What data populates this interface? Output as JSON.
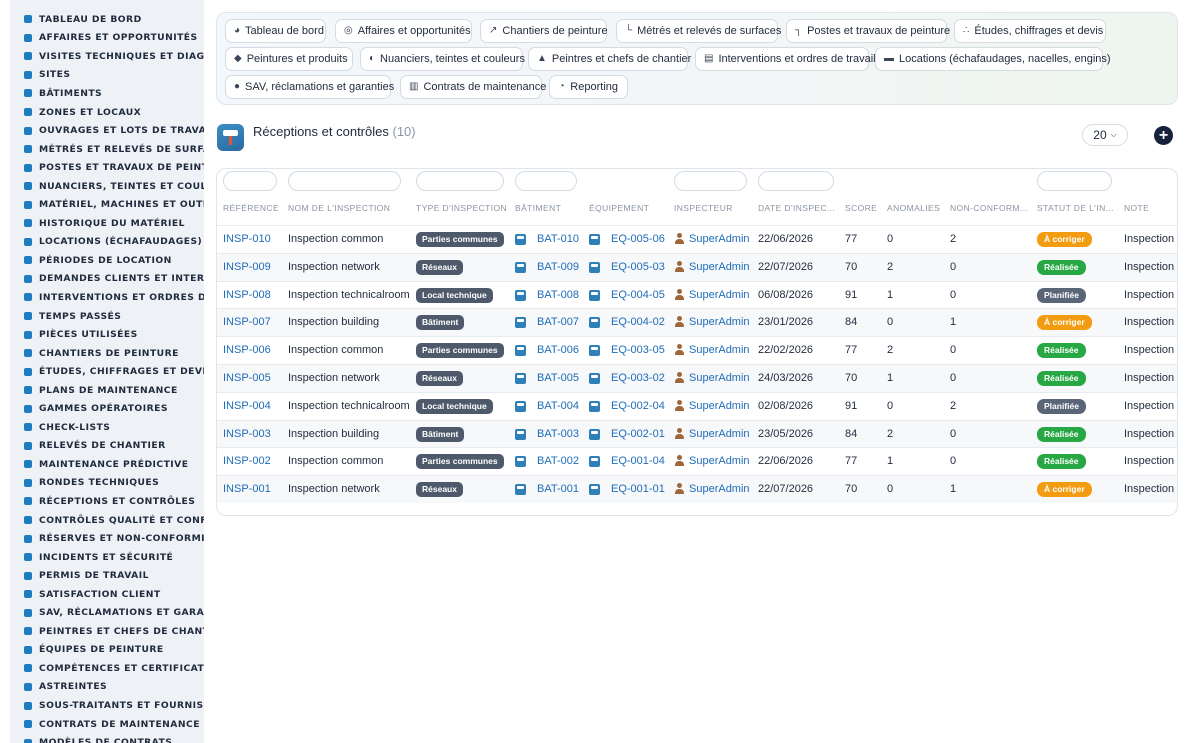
{
  "sidebar": {
    "items": [
      {
        "label": "TABLEAU DE BORD",
        "icon": "dashboard-icon"
      },
      {
        "label": "AFFAIRES ET OPPORTUNITÉS",
        "icon": "target-icon"
      },
      {
        "label": "VISITES TECHNIQUES ET DIAGNOSTICS",
        "icon": "clipboard-icon"
      },
      {
        "label": "SITES",
        "icon": "map-pin-icon"
      },
      {
        "label": "BÂTIMENTS",
        "icon": "building-icon"
      },
      {
        "label": "ZONES ET LOCAUX",
        "icon": "grid-icon"
      },
      {
        "label": "OUVRAGES ET LOTS DE TRAVAUX",
        "icon": "sitemap-icon"
      },
      {
        "label": "MÉTRÉS ET RELEVÉS DE SURFACES",
        "icon": "ruler-icon"
      },
      {
        "label": "POSTES ET TRAVAUX DE PEINTURE",
        "icon": "paint-roller-icon"
      },
      {
        "label": "NUANCIERS, TEINTES ET COULEURS",
        "icon": "palette-icon"
      },
      {
        "label": "MATÉRIEL, MACHINES ET OUTILLAGE",
        "icon": "cogs-icon"
      },
      {
        "label": "HISTORIQUE DU MATÉRIEL",
        "icon": "history-icon"
      },
      {
        "label": "LOCATIONS (ÉCHAFAUDAGES)",
        "icon": "truck-icon"
      },
      {
        "label": "PÉRIODES DE LOCATION",
        "icon": "calendar-icon"
      },
      {
        "label": "DEMANDES CLIENTS ET INTERVENTIONS",
        "icon": "inbox-icon"
      },
      {
        "label": "INTERVENTIONS ET ORDRES DE TRAVAIL",
        "icon": "tools-icon"
      },
      {
        "label": "TEMPS PASSÉS",
        "icon": "clock-icon"
      },
      {
        "label": "PIÈCES UTILISÉES",
        "icon": "box-icon"
      },
      {
        "label": "CHANTIERS DE PEINTURE",
        "icon": "brush-icon"
      },
      {
        "label": "ÉTUDES, CHIFFRAGES ET DEVIS",
        "icon": "calculator-icon"
      },
      {
        "label": "PLANS DE MAINTENANCE",
        "icon": "calendar-check-icon"
      },
      {
        "label": "GAMMES OPÉRATOIRES",
        "icon": "list-ordered-icon"
      },
      {
        "label": "CHECK-LISTS",
        "icon": "checklist-icon"
      },
      {
        "label": "RELEVÉS DE CHANTIER",
        "icon": "file-icon"
      },
      {
        "label": "MAINTENANCE PRÉDICTIVE",
        "icon": "chart-line-icon"
      },
      {
        "label": "RONDES TECHNIQUES",
        "icon": "route-icon"
      },
      {
        "label": "RÉCEPTIONS ET CONTRÔLES",
        "icon": "search-check-icon"
      },
      {
        "label": "CONTRÔLES QUALITÉ ET CONFORMITÉ",
        "icon": "clipboard-check-icon"
      },
      {
        "label": "RÉSERVES ET NON-CONFORMITÉS",
        "icon": "alert-circle-icon"
      },
      {
        "label": "INCIDENTS ET SÉCURITÉ",
        "icon": "warning-icon"
      },
      {
        "label": "PERMIS DE TRAVAIL",
        "icon": "file-signature-icon"
      },
      {
        "label": "SATISFACTION CLIENT",
        "icon": "smile-icon"
      },
      {
        "label": "SAV, RÉCLAMATIONS ET GARANTIES",
        "icon": "comments-icon"
      },
      {
        "label": "PEINTRES ET CHEFS DE CHANTIER",
        "icon": "hard-hat-icon"
      },
      {
        "label": "ÉQUIPES DE PEINTURE",
        "icon": "users-icon"
      },
      {
        "label": "COMPÉTENCES ET CERTIFICATIONS",
        "icon": "award-icon"
      },
      {
        "label": "ASTREINTES",
        "icon": "phone-icon"
      },
      {
        "label": "SOUS-TRAITANTS ET FOURNISSEURS",
        "icon": "handshake-icon"
      },
      {
        "label": "CONTRATS DE MAINTENANCE",
        "icon": "contract-icon"
      },
      {
        "label": "MODÈLES DE CONTRATS",
        "icon": "file-text-icon"
      }
    ]
  },
  "topnav": {
    "buttons": [
      {
        "label": "Tableau de bord",
        "icon": "dashboard-icon"
      },
      {
        "label": "Affaires et opportunités",
        "icon": "target-icon"
      },
      {
        "label": "Chantiers de peinture",
        "icon": "brush-icon"
      },
      {
        "label": "Métrés et relevés de surfaces",
        "icon": "ruler-icon"
      },
      {
        "label": "Postes et travaux de peinture",
        "icon": "paint-roller-icon"
      },
      {
        "label": "Études, chiffrages et devis",
        "icon": "sitemap-icon"
      },
      {
        "label": "Peintures et produits",
        "icon": "fill-drip-icon"
      },
      {
        "label": "Nuanciers, teintes et couleurs",
        "icon": "palette-icon"
      },
      {
        "label": "Peintres et chefs de chantier",
        "icon": "hard-hat-icon"
      },
      {
        "label": "Interventions et ordres de travail",
        "icon": "clipboard-icon"
      },
      {
        "label": "Locations (échafaudages, nacelles, engins)",
        "icon": "truck-icon"
      },
      {
        "label": "SAV, réclamations et garanties",
        "icon": "comment-icon"
      },
      {
        "label": "Contrats de maintenance",
        "icon": "contract-icon"
      },
      {
        "label": "Reporting",
        "icon": "pie-chart-icon"
      }
    ]
  },
  "page": {
    "title": "Réceptions et contrôles",
    "count": "(10)",
    "per_page": "20",
    "add_label": "+"
  },
  "table": {
    "columns": [
      "RÉFÉRENCE",
      "NOM DE L'INSPECTION",
      "TYPE D'INSPECTION",
      "BÂTIMENT",
      "ÉQUIPEMENT",
      "INSPECTEUR",
      "DATE D'INSPEC...",
      "SCORE",
      "ANOMALIES",
      "NON-CONFORM...",
      "STATUT DE L'IN...",
      "NOTE"
    ],
    "rows": [
      {
        "ref": "INSP-010",
        "name": "Inspection common",
        "type": "Parties communes",
        "building": "BAT-010",
        "equipment": "EQ-005-06",
        "inspector": "SuperAdmin",
        "date": "22/06/2026",
        "score": "77",
        "anomalies": "0",
        "nonconf": "2",
        "status": "À corriger",
        "note": "Inspection planifiée"
      },
      {
        "ref": "INSP-009",
        "name": "Inspection network",
        "type": "Réseaux",
        "building": "BAT-009",
        "equipment": "EQ-005-03",
        "inspector": "SuperAdmin",
        "date": "22/07/2026",
        "score": "70",
        "anomalies": "2",
        "nonconf": "0",
        "status": "Réalisée",
        "note": "Inspection planifiée"
      },
      {
        "ref": "INSP-008",
        "name": "Inspection technicalroom",
        "type": "Local technique",
        "building": "BAT-008",
        "equipment": "EQ-004-05",
        "inspector": "SuperAdmin",
        "date": "06/08/2026",
        "score": "91",
        "anomalies": "1",
        "nonconf": "0",
        "status": "Planifiée",
        "note": "Inspection planifiée"
      },
      {
        "ref": "INSP-007",
        "name": "Inspection building",
        "type": "Bâtiment",
        "building": "BAT-007",
        "equipment": "EQ-004-02",
        "inspector": "SuperAdmin",
        "date": "23/01/2026",
        "score": "84",
        "anomalies": "0",
        "nonconf": "1",
        "status": "À corriger",
        "note": "Inspection planifiée"
      },
      {
        "ref": "INSP-006",
        "name": "Inspection common",
        "type": "Parties communes",
        "building": "BAT-006",
        "equipment": "EQ-003-05",
        "inspector": "SuperAdmin",
        "date": "22/02/2026",
        "score": "77",
        "anomalies": "2",
        "nonconf": "0",
        "status": "Réalisée",
        "note": "Inspection planifiée"
      },
      {
        "ref": "INSP-005",
        "name": "Inspection network",
        "type": "Réseaux",
        "building": "BAT-005",
        "equipment": "EQ-003-02",
        "inspector": "SuperAdmin",
        "date": "24/03/2026",
        "score": "70",
        "anomalies": "1",
        "nonconf": "0",
        "status": "Réalisée",
        "note": "Inspection planifiée"
      },
      {
        "ref": "INSP-004",
        "name": "Inspection technicalroom",
        "type": "Local technique",
        "building": "BAT-004",
        "equipment": "EQ-002-04",
        "inspector": "SuperAdmin",
        "date": "02/08/2026",
        "score": "91",
        "anomalies": "0",
        "nonconf": "2",
        "status": "Planifiée",
        "note": "Inspection planifiée"
      },
      {
        "ref": "INSP-003",
        "name": "Inspection building",
        "type": "Bâtiment",
        "building": "BAT-003",
        "equipment": "EQ-002-01",
        "inspector": "SuperAdmin",
        "date": "23/05/2026",
        "score": "84",
        "anomalies": "2",
        "nonconf": "0",
        "status": "Réalisée",
        "note": "Inspection planifiée"
      },
      {
        "ref": "INSP-002",
        "name": "Inspection common",
        "type": "Parties communes",
        "building": "BAT-002",
        "equipment": "EQ-001-04",
        "inspector": "SuperAdmin",
        "date": "22/06/2026",
        "score": "77",
        "anomalies": "1",
        "nonconf": "0",
        "status": "Réalisée",
        "note": "Inspection planifiée"
      },
      {
        "ref": "INSP-001",
        "name": "Inspection network",
        "type": "Réseaux",
        "building": "BAT-001",
        "equipment": "EQ-001-01",
        "inspector": "SuperAdmin",
        "date": "22/07/2026",
        "score": "70",
        "anomalies": "0",
        "nonconf": "1",
        "status": "À corriger",
        "note": "Inspection planifiée"
      }
    ]
  },
  "colors": {
    "status": {
      "À corriger": "#f39c12",
      "Réalisée": "#27a844",
      "Planifiée": "#5a6678"
    },
    "link": "#1e6cb8",
    "sidebar_icon": "#1e7dc1"
  }
}
